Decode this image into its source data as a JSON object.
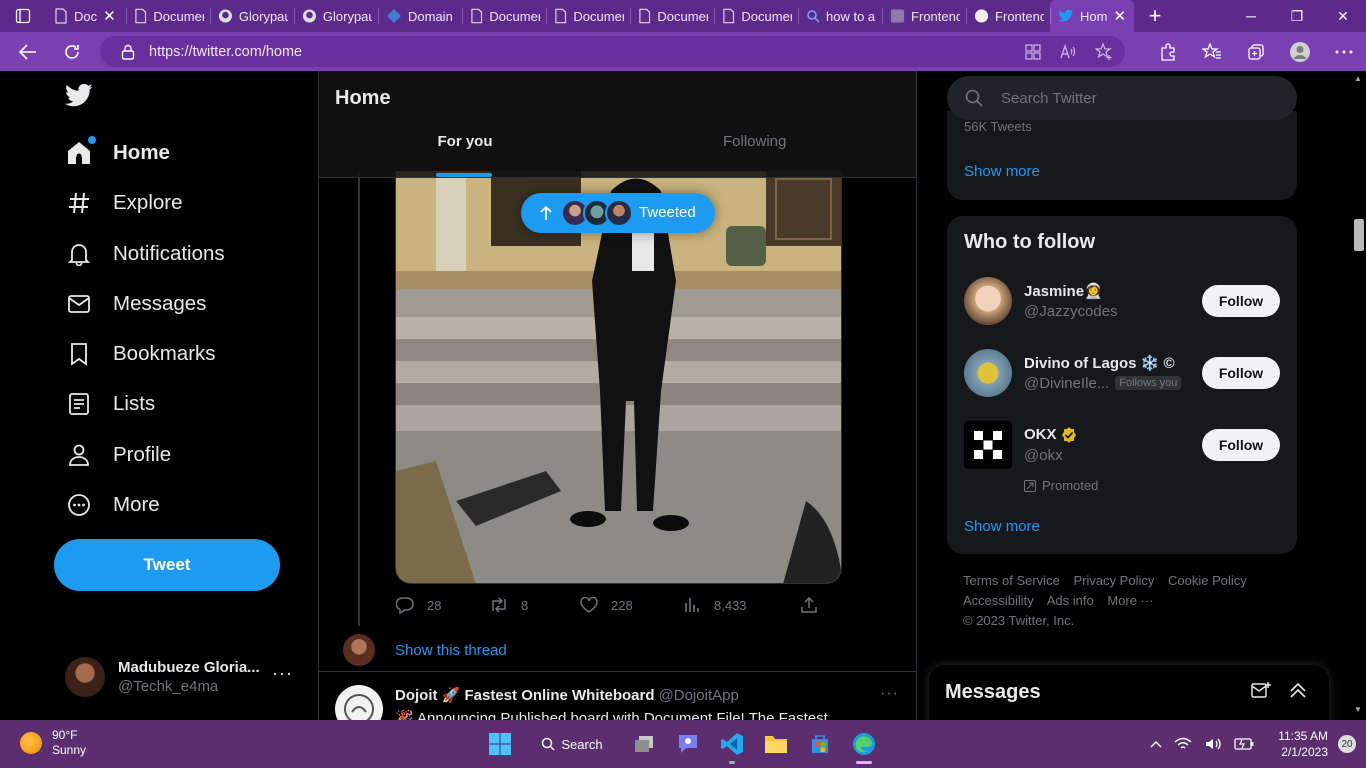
{
  "browser": {
    "tabs": [
      {
        "title": "Doc",
        "icon": "document-icon"
      },
      {
        "title": "Documer",
        "icon": "document-icon"
      },
      {
        "title": "Glorypau",
        "icon": "github-icon"
      },
      {
        "title": "Glorypau",
        "icon": "github-icon"
      },
      {
        "title": "Domain",
        "icon": "domain-icon"
      },
      {
        "title": "Documer",
        "icon": "document-icon"
      },
      {
        "title": "Documer",
        "icon": "document-icon"
      },
      {
        "title": "Documer",
        "icon": "document-icon"
      },
      {
        "title": "Documer",
        "icon": "document-icon"
      },
      {
        "title": "how to a",
        "icon": "search-icon"
      },
      {
        "title": "Frontend",
        "icon": "frontend-icon"
      },
      {
        "title": "Frontend",
        "icon": "frontend-icon"
      },
      {
        "title": "Hom",
        "icon": "twitter-icon"
      }
    ],
    "url": "https://twitter.com/home"
  },
  "sidebar": {
    "items": [
      {
        "label": "Home",
        "icon": "home-icon"
      },
      {
        "label": "Explore",
        "icon": "hashtag-icon"
      },
      {
        "label": "Notifications",
        "icon": "bell-icon"
      },
      {
        "label": "Messages",
        "icon": "mail-icon"
      },
      {
        "label": "Bookmarks",
        "icon": "bookmark-icon"
      },
      {
        "label": "Lists",
        "icon": "list-icon"
      },
      {
        "label": "Profile",
        "icon": "person-icon"
      },
      {
        "label": "More",
        "icon": "more-circle-icon"
      }
    ],
    "tweet_button": "Tweet",
    "account": {
      "name": "Madubueze Gloria...",
      "handle": "@Techk_e4ma"
    }
  },
  "main": {
    "title": "Home",
    "tabs": [
      {
        "label": "For you"
      },
      {
        "label": "Following"
      }
    ],
    "tweeted_pill": "Tweeted",
    "actions": {
      "replies": "28",
      "retweets": "8",
      "likes": "228",
      "views": "8,433"
    },
    "show_thread": "Show this thread",
    "next_tweet": {
      "name": "Dojoit 🚀 Fastest Online Whiteboard",
      "handle": "@DojoitApp",
      "text": "🎉 Announcing Published board with Document File! The Fastest"
    }
  },
  "right": {
    "search_placeholder": "Search Twitter",
    "trend_count": "56K Tweets",
    "show_more": "Show more",
    "who_to_follow": {
      "title": "Who to follow",
      "people": [
        {
          "name": "Jasmine👩‍🚀",
          "handle": "@Jazzycodes",
          "button": "Follow"
        },
        {
          "name": "Divino of Lagos ❄️ ©",
          "handle": "@DivineIle...",
          "badge": "Follows you",
          "button": "Follow"
        },
        {
          "name": "OKX",
          "handle": "@okx",
          "promoted": "Promoted",
          "button": "Follow"
        }
      ],
      "show_more": "Show more"
    },
    "footer": [
      "Terms of Service",
      "Privacy Policy",
      "Cookie Policy",
      "Accessibility",
      "Ads info",
      "More ···",
      "© 2023 Twitter, Inc."
    ],
    "messages_title": "Messages"
  },
  "taskbar": {
    "weather_temp": "90°F",
    "weather_desc": "Sunny",
    "search_label": "Search",
    "time": "11:35 AM",
    "date": "2/1/2023",
    "notifications": "20"
  },
  "colors": {
    "accent": "#1d9bf0",
    "browser_frame": "#7b3fb4",
    "taskbar": "#5a2e6f"
  }
}
